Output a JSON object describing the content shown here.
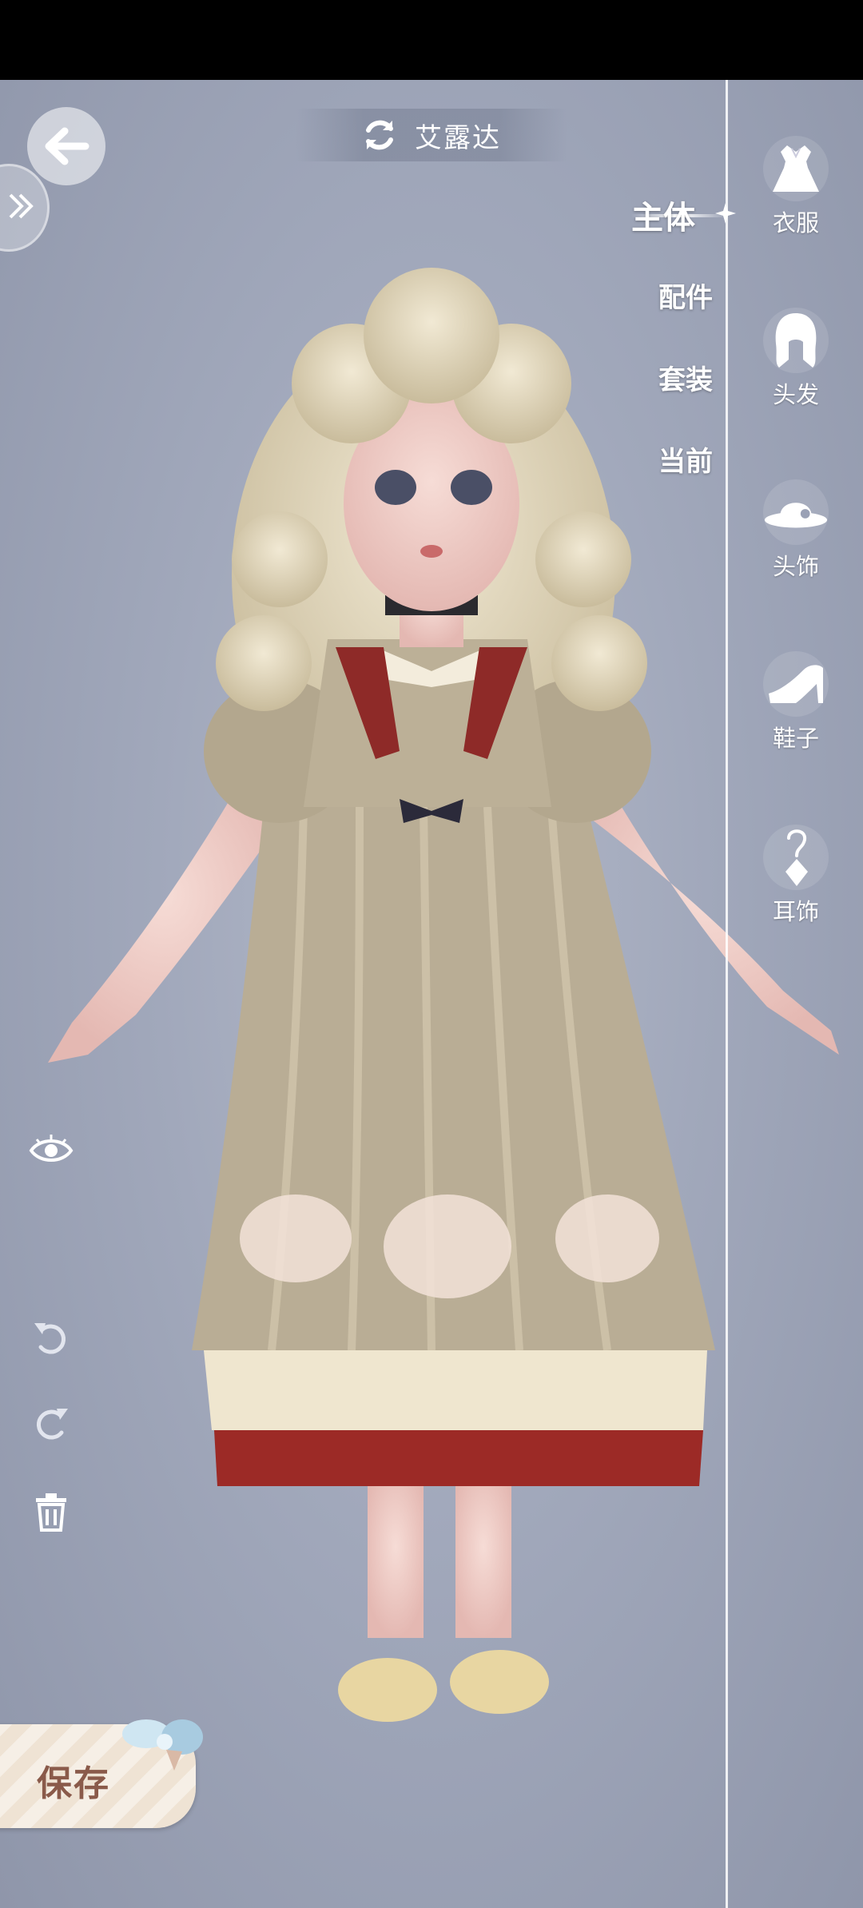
{
  "header": {
    "character_name": "艾露达",
    "swap_icon": "refresh-icon",
    "back_icon": "arrow-left-icon",
    "expand_icon": "double-chevron-right-icon"
  },
  "category_tabs": [
    {
      "label": "主体",
      "active": true
    },
    {
      "label": "配件",
      "active": false
    },
    {
      "label": "套装",
      "active": false
    },
    {
      "label": "当前",
      "active": false
    }
  ],
  "right_sidebar": [
    {
      "label": "衣服",
      "icon": "dress-icon"
    },
    {
      "label": "头发",
      "icon": "hair-icon"
    },
    {
      "label": "头饰",
      "icon": "hat-icon"
    },
    {
      "label": "鞋子",
      "icon": "high-heel-icon"
    },
    {
      "label": "耳饰",
      "icon": "earring-icon"
    }
  ],
  "tools": [
    {
      "name": "visibility-toggle",
      "icon": "eye-icon"
    },
    {
      "name": "undo",
      "icon": "undo-icon"
    },
    {
      "name": "redo",
      "icon": "redo-icon"
    },
    {
      "name": "delete",
      "icon": "trash-icon"
    }
  ],
  "save_button": {
    "label": "保存"
  },
  "colors": {
    "background": "#a1a8bb",
    "text": "#ffffff",
    "save_text": "#8a5a4a",
    "dress": "#b7ab94",
    "hair": "#e6dcc3",
    "hem": "#9c2a26"
  }
}
